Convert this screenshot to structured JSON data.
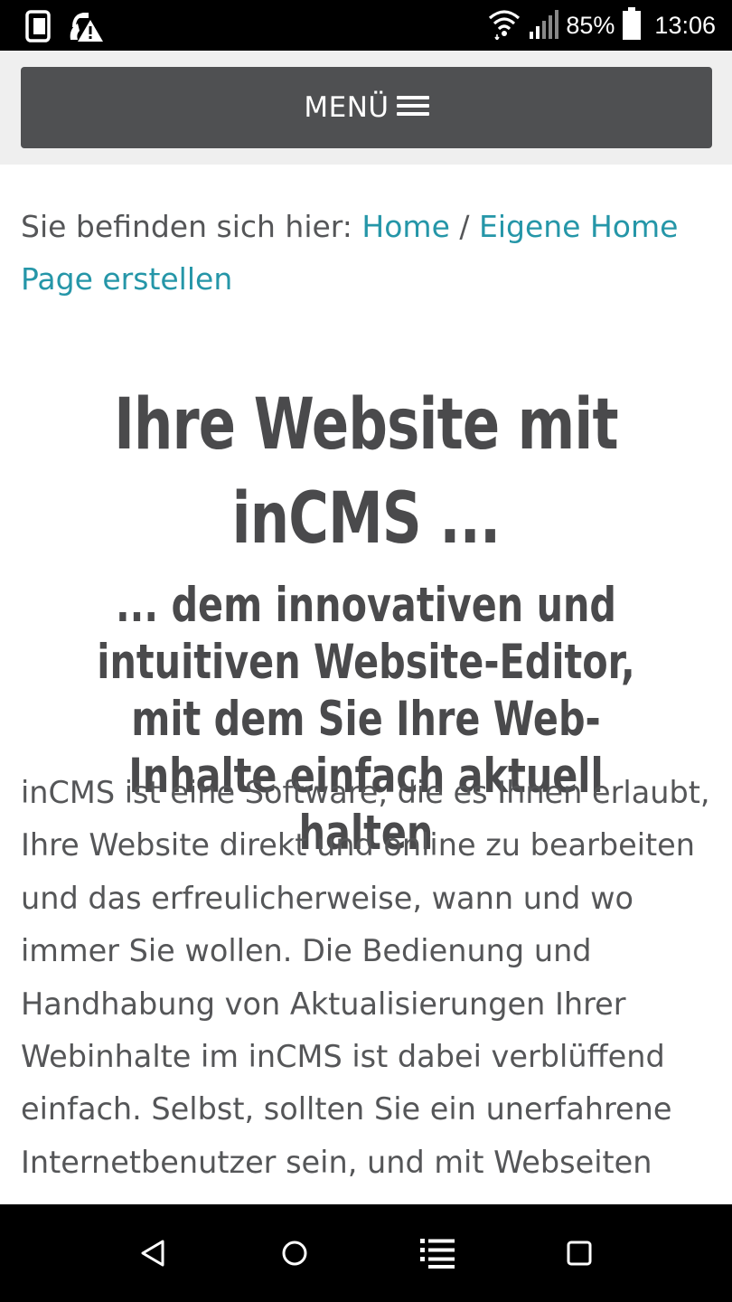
{
  "status_bar": {
    "battery": "85%",
    "time": "13:06",
    "icons": [
      "phone-screen-icon",
      "no-sim-alert-icon",
      "wifi-icon",
      "signal-icon",
      "battery-icon"
    ]
  },
  "menu": {
    "label": "MENÜ",
    "icon": "hamburger-icon",
    "background": "#4f5052"
  },
  "breadcrumb": {
    "prefix": "Sie befinden sich hier:",
    "items": [
      "Home",
      "Eigene Home Page erstellen"
    ],
    "separator": "/",
    "link_color": "#2596a8"
  },
  "main": {
    "title": "Ihre Website mit inCMS ...",
    "subtitle": "... dem innovativen und intuitiven Website-Editor, mit dem Sie Ihre Web-Inhalte einfach aktuell halten",
    "body": "inCMS ist eine Software, die es Ihnen erlaubt, Ihre Website direkt und online zu bearbeiten und das erfreulicherweise, wann und wo immer Sie wollen. Die Bedienung und Handhabung von Aktualisierungen Ihrer Webinhalte im inCMS ist dabei verblüffend einfach. Selbst, sollten Sie ein unerfahrene Internetbenutzer sein, und mit Webseiten"
  },
  "nav_bar": {
    "buttons": [
      "back-icon",
      "home-icon",
      "menu-list-icon",
      "recents-icon"
    ]
  }
}
